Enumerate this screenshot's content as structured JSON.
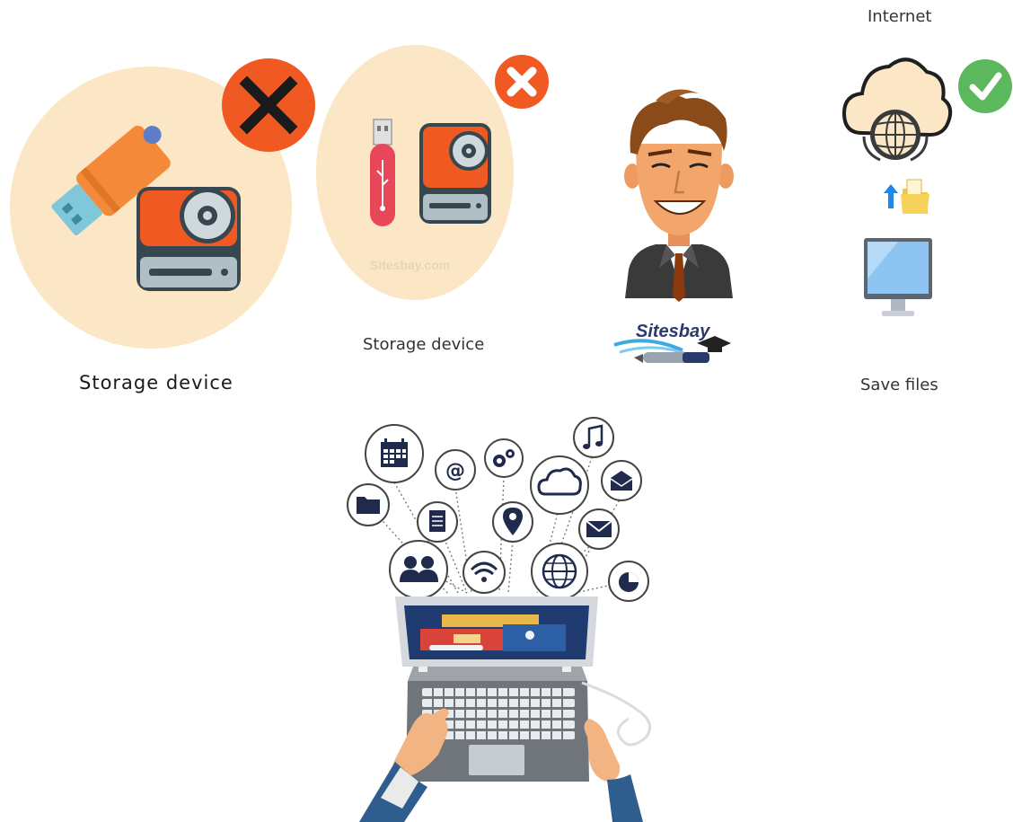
{
  "labels": {
    "storage_device_1": "Storage device",
    "storage_device_2": "Storage device",
    "internet": "Internet",
    "save_files": "Save files"
  },
  "watermark": "Sitesbay.com",
  "logo": "Sitesbay",
  "icons": {
    "usb_drive": "usb-drive-icon",
    "hard_drive": "hard-drive-icon",
    "cross": "cross-icon",
    "check": "check-icon",
    "cloud_globe": "cloud-globe-icon",
    "upload_folder": "upload-folder-icon",
    "monitor": "monitor-icon",
    "person": "person-icon",
    "laptop": "laptop-icon"
  },
  "colors": {
    "peach": "#fbe7c6",
    "orange_red": "#f05a22",
    "green_check": "#5cb85c",
    "navy": "#1f2a4d"
  }
}
